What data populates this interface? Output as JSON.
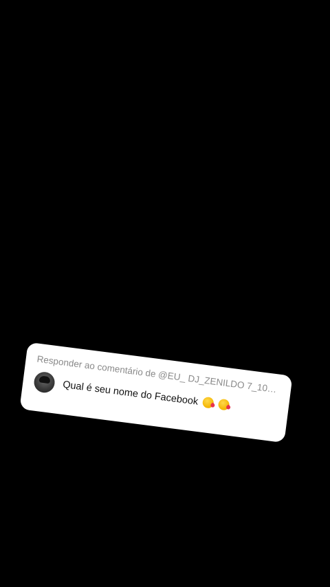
{
  "reply": {
    "header_prefix": "Responder ao comentário de ",
    "handle": "@EU_ DJ_ZENILDO 7_100%_...",
    "comment": "Qual é seu nome do Facebook",
    "emojis": [
      "kissing-face-heart-icon",
      "kissing-face-heart-icon"
    ]
  }
}
